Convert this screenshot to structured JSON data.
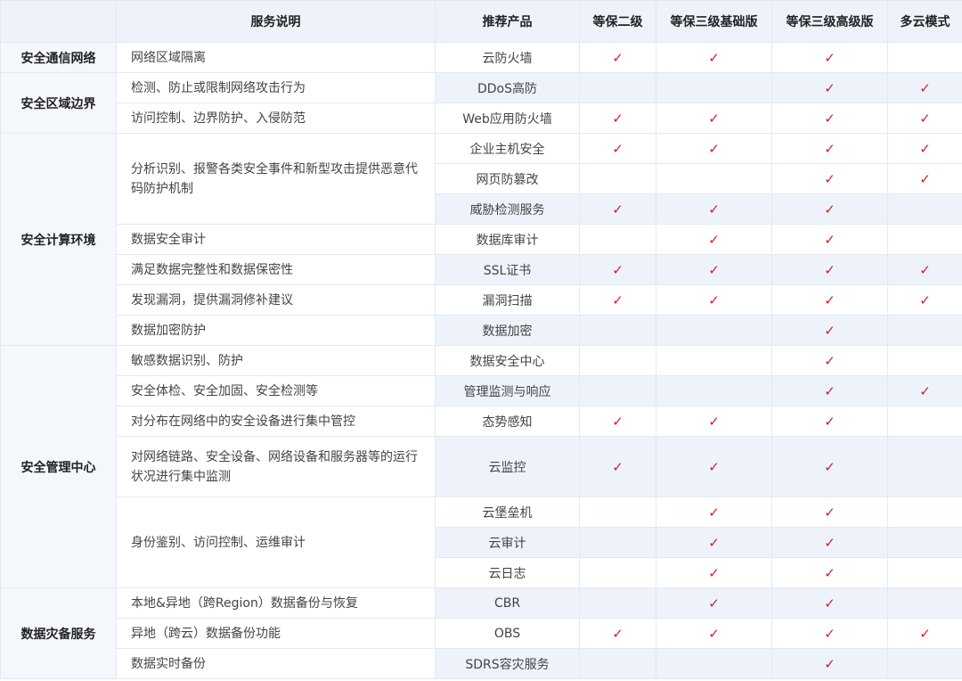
{
  "header": {
    "category": "",
    "description": "服务说明",
    "product": "推荐产品",
    "levels": [
      "等保二级",
      "等保三级基础版",
      "等保三级高级版",
      "多云模式"
    ]
  },
  "check_glyph": "✓",
  "check_color": "#cf1f2e",
  "categories": [
    "安全通信网络",
    "安全区域边界",
    "安全计算环境",
    "安全管理中心",
    "数据灾备服务"
  ],
  "descriptions": [
    "网络区域隔离",
    "检测、防止或限制网络攻击行为",
    "访问控制、边界防护、入侵防范",
    "分析识别、报警各类安全事件和新型攻击提供恶意代码防护机制",
    "数据安全审计",
    "满足数据完整性和数据保密性",
    "发现漏洞，提供漏洞修补建议",
    "数据加密防护",
    "敏感数据识别、防护",
    "安全体检、安全加固、安全检测等",
    "对分布在网络中的安全设备进行集中管控",
    "对网络链路、安全设备、网络设备和服务器等的运行状况进行集中监测",
    "身份鉴别、访问控制、运维审计",
    "本地&异地（跨Region）数据备份与恢复",
    "异地（跨云）数据备份功能",
    "数据实时备份"
  ],
  "rows": [
    {
      "product": "云防火墙",
      "checks": [
        true,
        true,
        true,
        false
      ]
    },
    {
      "product": "DDoS高防",
      "checks": [
        false,
        false,
        true,
        true
      ]
    },
    {
      "product": "Web应用防火墙",
      "checks": [
        true,
        true,
        true,
        true
      ]
    },
    {
      "product": "企业主机安全",
      "checks": [
        true,
        true,
        true,
        true
      ]
    },
    {
      "product": "网页防篡改",
      "checks": [
        false,
        false,
        true,
        true
      ]
    },
    {
      "product": "威胁检测服务",
      "checks": [
        true,
        true,
        true,
        false
      ]
    },
    {
      "product": "数据库审计",
      "checks": [
        false,
        true,
        true,
        false
      ]
    },
    {
      "product": "SSL证书",
      "checks": [
        true,
        true,
        true,
        true
      ]
    },
    {
      "product": "漏洞扫描",
      "checks": [
        true,
        true,
        true,
        true
      ]
    },
    {
      "product": "数据加密",
      "checks": [
        false,
        false,
        true,
        false
      ]
    },
    {
      "product": "数据安全中心",
      "checks": [
        false,
        false,
        true,
        false
      ]
    },
    {
      "product": "管理监测与响应",
      "checks": [
        false,
        false,
        true,
        true
      ]
    },
    {
      "product": "态势感知",
      "checks": [
        true,
        true,
        true,
        false
      ]
    },
    {
      "product": "云监控",
      "checks": [
        true,
        true,
        true,
        false
      ]
    },
    {
      "product": "云堡垒机",
      "checks": [
        false,
        true,
        true,
        false
      ]
    },
    {
      "product": "云审计",
      "checks": [
        false,
        true,
        true,
        false
      ]
    },
    {
      "product": "云日志",
      "checks": [
        false,
        true,
        true,
        false
      ]
    },
    {
      "product": "CBR",
      "checks": [
        false,
        true,
        true,
        false
      ]
    },
    {
      "product": "OBS",
      "checks": [
        true,
        true,
        true,
        true
      ]
    },
    {
      "product": "SDRS容灾服务",
      "checks": [
        false,
        false,
        true,
        false
      ]
    }
  ]
}
